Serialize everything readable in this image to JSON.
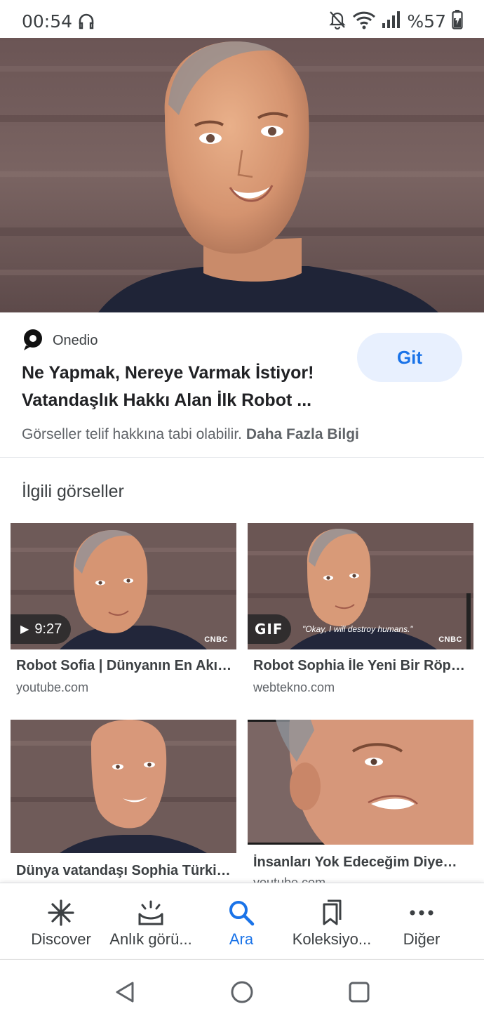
{
  "status_bar": {
    "time": "00:54",
    "battery_percent": "%57",
    "icons": [
      "headset-icon",
      "mute-notifications-icon",
      "wifi-icon",
      "signal-icon",
      "battery-icon"
    ]
  },
  "result": {
    "source_name": "Onedio",
    "title": "Ne Yapmak, Nereye Varmak İstiyor! Vatandaşlık Hakkı Alan İlk Robot ...",
    "visit_button": "Git",
    "copyright_text": "Görseller telif hakkına tabi olabilir.",
    "more_info_link": "Daha Fazla Bilgi"
  },
  "related": {
    "heading": "İlgili görseller",
    "items": [
      {
        "caption": "Robot Sofia | Dünyanın En Akıllı Robotu",
        "domain": "youtube.com",
        "badge": "9:27",
        "watermark": "CNBC"
      },
      {
        "caption": "Robot Sophia İle Yeni Bir Röportaj",
        "domain": "webtekno.com",
        "badge": "GIF",
        "subtitle": "\"Okay, I will destroy humans.\"",
        "watermark": "CNBC"
      },
      {
        "caption": "Dünya vatandaşı Sophia Türkiye'de",
        "domain": "",
        "badge": ""
      },
      {
        "caption": "İnsanları Yok Edeceğim Diyen Robot",
        "domain": "youtube.com",
        "badge": ""
      }
    ]
  },
  "bottom_nav": {
    "items": [
      {
        "label": "Discover",
        "icon": "asterisk-icon",
        "active": false
      },
      {
        "label": "Anlık görü...",
        "icon": "snapshot-icon",
        "active": false
      },
      {
        "label": "Ara",
        "icon": "search-icon",
        "active": true
      },
      {
        "label": "Koleksiyo...",
        "icon": "collections-icon",
        "active": false
      },
      {
        "label": "Diğer",
        "icon": "more-icon",
        "active": false
      }
    ]
  },
  "colors": {
    "accent": "#1a73e8",
    "button_bg": "#e8f0fe",
    "text_primary": "#202124",
    "text_secondary": "#5f6368"
  }
}
